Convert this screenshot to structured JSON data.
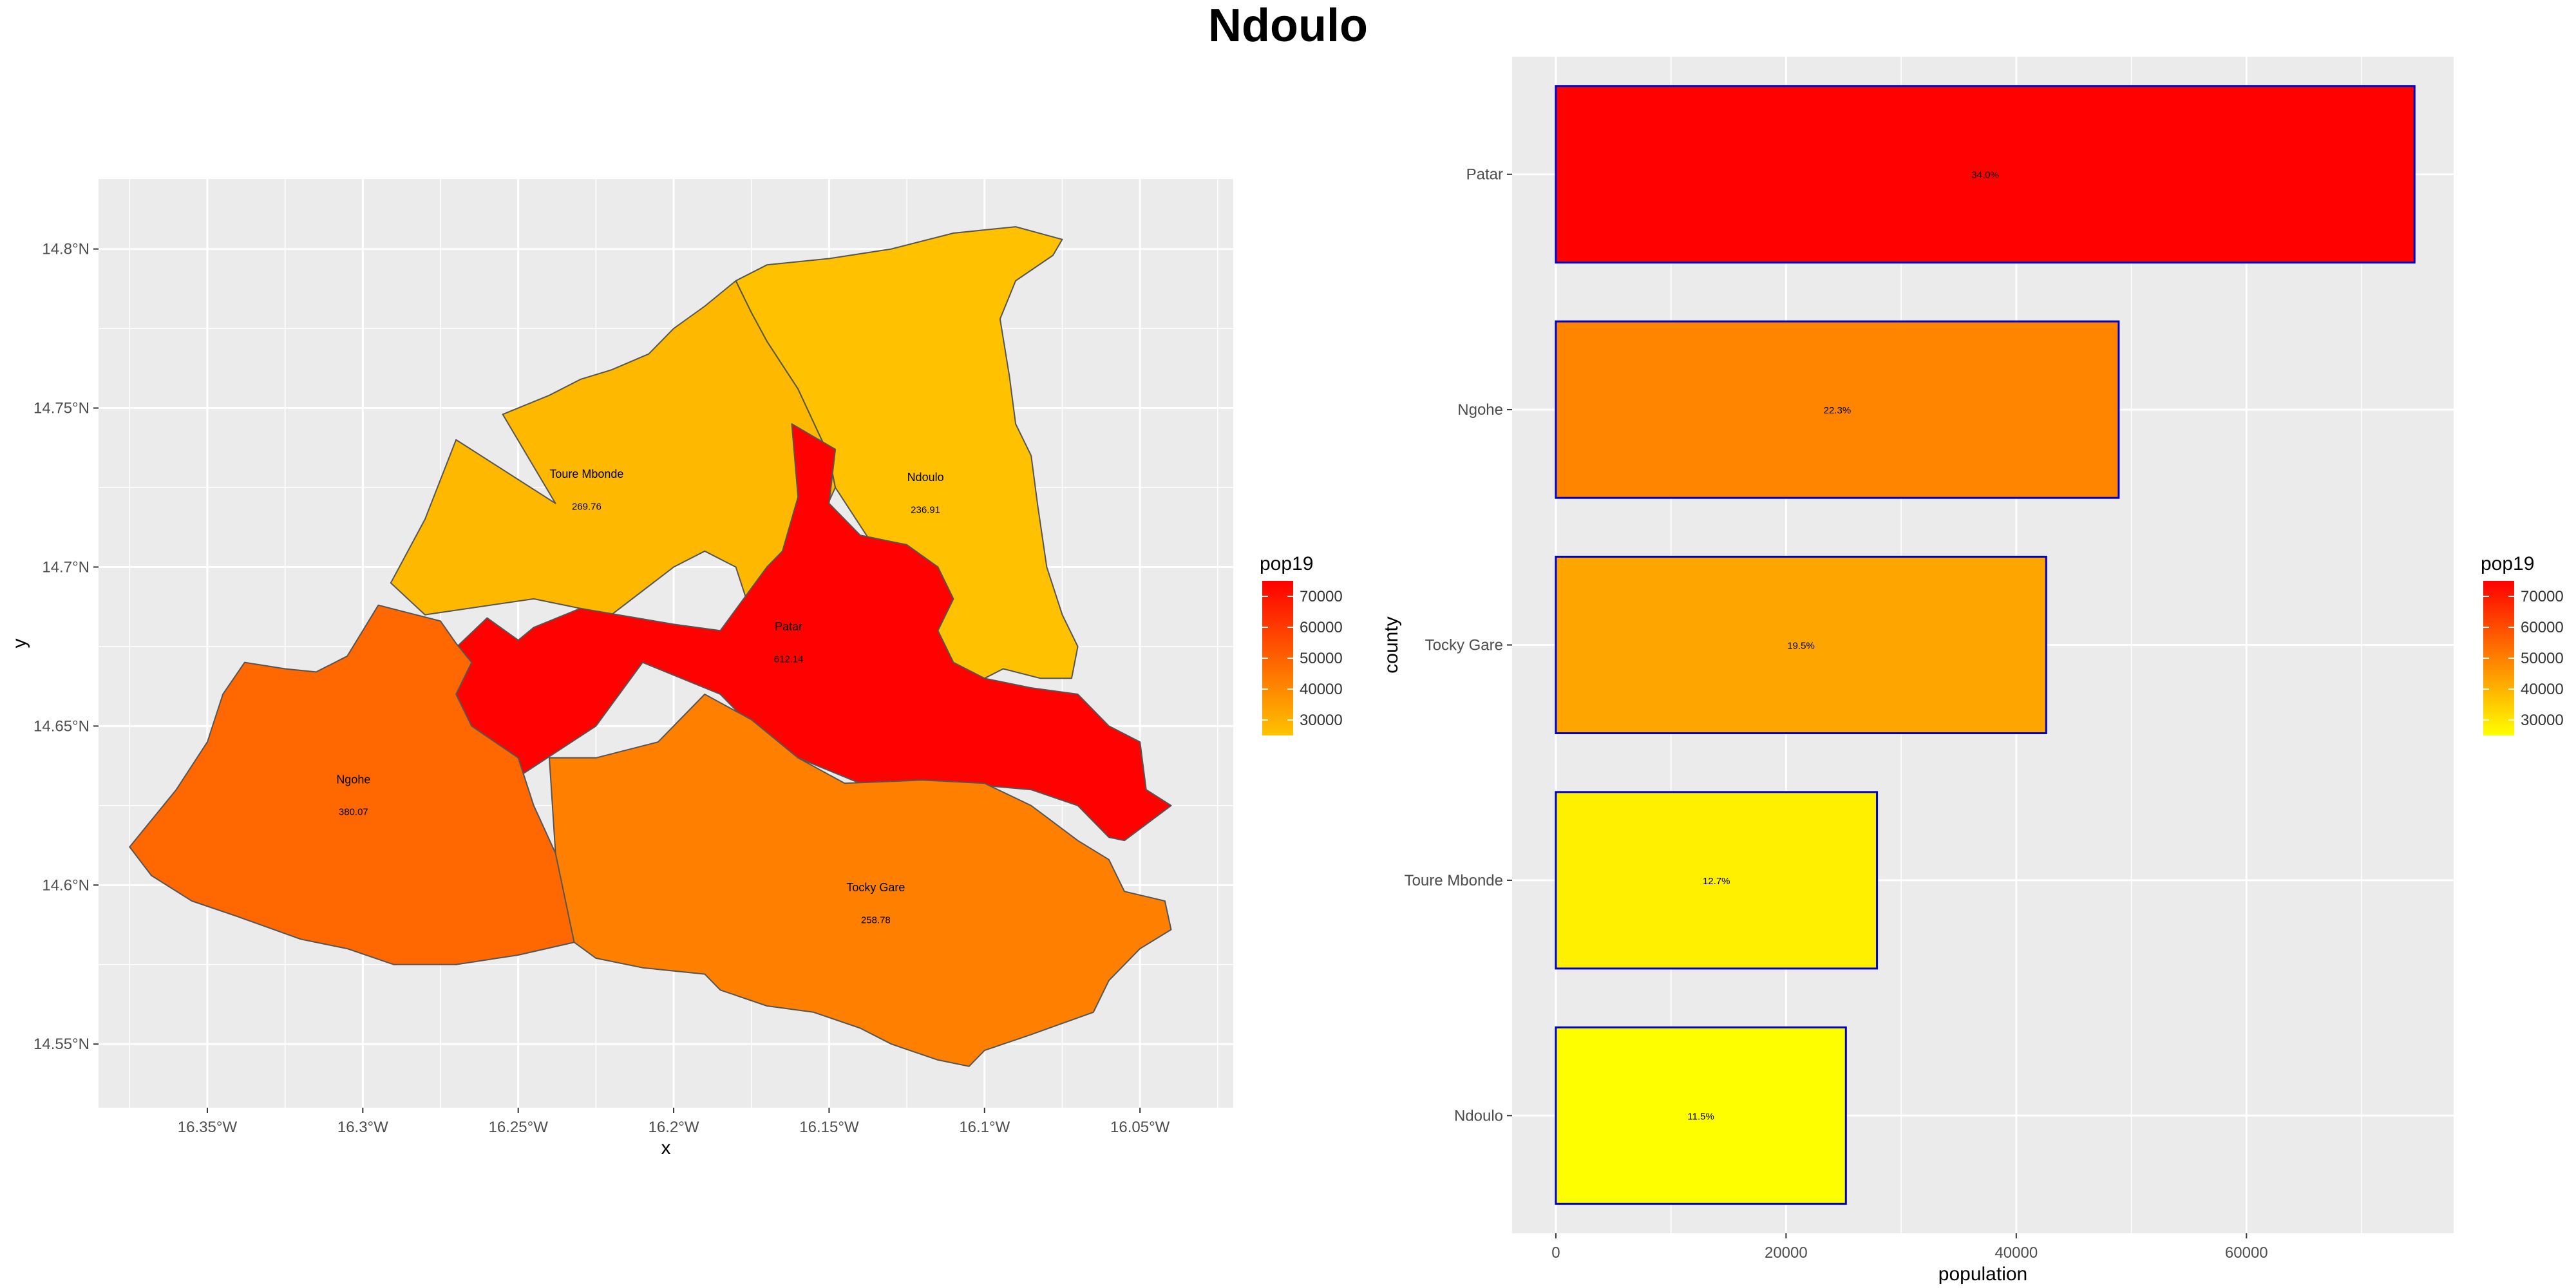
{
  "title": "Ndoulo",
  "colors": {
    "panel_bg": "#EBEBEB",
    "grid": "#FFFFFF",
    "map_low": "#FFC300",
    "map_high": "#FF0000",
    "bar_low": "#FFFF00",
    "bar_high": "#FF0000",
    "bar_outline": "#0000CD",
    "region_outline": "#555555"
  },
  "chart_data": [
    {
      "type": "map",
      "xlabel": "x",
      "ylabel": "y",
      "xlim": [
        -16.385,
        -16.02
      ],
      "ylim": [
        14.53,
        14.822
      ],
      "x_ticks": [
        {
          "value": -16.35,
          "label": "16.35°W"
        },
        {
          "value": -16.3,
          "label": "16.3°W"
        },
        {
          "value": -16.25,
          "label": "16.25°W"
        },
        {
          "value": -16.2,
          "label": "16.2°W"
        },
        {
          "value": -16.15,
          "label": "16.15°W"
        },
        {
          "value": -16.1,
          "label": "16.1°W"
        },
        {
          "value": -16.05,
          "label": "16.05°W"
        }
      ],
      "y_ticks": [
        {
          "value": 14.55,
          "label": "14.55°N"
        },
        {
          "value": 14.6,
          "label": "14.6°N"
        },
        {
          "value": 14.65,
          "label": "14.65°N"
        },
        {
          "value": 14.7,
          "label": "14.7°N"
        },
        {
          "value": 14.75,
          "label": "14.75°N"
        },
        {
          "value": 14.8,
          "label": "14.8°N"
        }
      ],
      "legend": {
        "title": "pop19",
        "placement": "right",
        "range": [
          25000,
          75000
        ],
        "ticks": [
          "70000",
          "60000",
          "50000",
          "40000",
          "30000"
        ]
      },
      "regions": [
        {
          "name": "Toure Mbonde",
          "value_label": "269.76",
          "pop19": 27900,
          "label_pos": [
            -16.228,
            14.728
          ],
          "value_pos": [
            -16.228,
            14.718
          ],
          "polygon": [
            [
              -16.238,
              14.72
            ],
            [
              -16.255,
              14.748
            ],
            [
              -16.24,
              14.754
            ],
            [
              -16.23,
              14.759
            ],
            [
              -16.22,
              14.762
            ],
            [
              -16.208,
              14.767
            ],
            [
              -16.2,
              14.775
            ],
            [
              -16.19,
              14.782
            ],
            [
              -16.18,
              14.79
            ],
            [
              -16.175,
              14.78
            ],
            [
              -16.17,
              14.771
            ],
            [
              -16.16,
              14.756
            ],
            [
              -16.15,
              14.735
            ],
            [
              -16.148,
              14.725
            ],
            [
              -16.155,
              14.71
            ],
            [
              -16.16,
              14.7
            ],
            [
              -16.17,
              14.69
            ],
            [
              -16.175,
              14.685
            ],
            [
              -16.18,
              14.7
            ],
            [
              -16.19,
              14.705
            ],
            [
              -16.2,
              14.7
            ],
            [
              -16.22,
              14.685
            ],
            [
              -16.245,
              14.69
            ],
            [
              -16.28,
              14.685
            ],
            [
              -16.291,
              14.695
            ],
            [
              -16.28,
              14.715
            ],
            [
              -16.27,
              14.74
            ]
          ]
        },
        {
          "name": "Ndoulo",
          "value_label": "236.91",
          "pop19": 25500,
          "label_pos": [
            -16.119,
            14.727
          ],
          "value_pos": [
            -16.119,
            14.717
          ],
          "polygon": [
            [
              -16.18,
              14.79
            ],
            [
              -16.17,
              14.795
            ],
            [
              -16.15,
              14.797
            ],
            [
              -16.13,
              14.8
            ],
            [
              -16.11,
              14.805
            ],
            [
              -16.09,
              14.807
            ],
            [
              -16.075,
              14.803
            ],
            [
              -16.078,
              14.798
            ],
            [
              -16.09,
              14.79
            ],
            [
              -16.095,
              14.778
            ],
            [
              -16.092,
              14.76
            ],
            [
              -16.09,
              14.745
            ],
            [
              -16.085,
              14.735
            ],
            [
              -16.083,
              14.72
            ],
            [
              -16.08,
              14.7
            ],
            [
              -16.075,
              14.685
            ],
            [
              -16.07,
              14.675
            ],
            [
              -16.072,
              14.665
            ],
            [
              -16.082,
              14.665
            ],
            [
              -16.094,
              14.668
            ],
            [
              -16.1,
              14.665
            ],
            [
              -16.11,
              14.668
            ],
            [
              -16.115,
              14.672
            ],
            [
              -16.116,
              14.68
            ],
            [
              -16.118,
              14.688
            ],
            [
              -16.13,
              14.7
            ],
            [
              -16.138,
              14.71
            ],
            [
              -16.148,
              14.725
            ],
            [
              -16.15,
              14.735
            ],
            [
              -16.16,
              14.756
            ],
            [
              -16.17,
              14.771
            ],
            [
              -16.175,
              14.78
            ]
          ]
        },
        {
          "name": "Patar",
          "value_label": "612.14",
          "pop19": 74600,
          "label_pos": [
            -16.163,
            14.68
          ],
          "value_pos": [
            -16.163,
            14.67
          ],
          "polygon": [
            [
              -16.275,
              14.67
            ],
            [
              -16.26,
              14.684
            ],
            [
              -16.25,
              14.677
            ],
            [
              -16.245,
              14.681
            ],
            [
              -16.23,
              14.687
            ],
            [
              -16.2,
              14.682
            ],
            [
              -16.185,
              14.68
            ],
            [
              -16.17,
              14.7
            ],
            [
              -16.165,
              14.705
            ],
            [
              -16.16,
              14.722
            ],
            [
              -16.162,
              14.745
            ],
            [
              -16.148,
              14.737
            ],
            [
              -16.15,
              14.72
            ],
            [
              -16.14,
              14.71
            ],
            [
              -16.125,
              14.707
            ],
            [
              -16.115,
              14.7
            ],
            [
              -16.11,
              14.69
            ],
            [
              -16.115,
              14.68
            ],
            [
              -16.11,
              14.67
            ],
            [
              -16.1,
              14.665
            ],
            [
              -16.085,
              14.662
            ],
            [
              -16.07,
              14.66
            ],
            [
              -16.06,
              14.65
            ],
            [
              -16.05,
              14.645
            ],
            [
              -16.048,
              14.63
            ],
            [
              -16.04,
              14.625
            ],
            [
              -16.055,
              14.614
            ],
            [
              -16.06,
              14.615
            ],
            [
              -16.07,
              14.625
            ],
            [
              -16.085,
              14.63
            ],
            [
              -16.12,
              14.633
            ],
            [
              -16.14,
              14.632
            ],
            [
              -16.16,
              14.64
            ],
            [
              -16.175,
              14.65
            ],
            [
              -16.185,
              14.66
            ],
            [
              -16.21,
              14.67
            ],
            [
              -16.225,
              14.65
            ],
            [
              -16.25,
              14.634
            ],
            [
              -16.265,
              14.65
            ],
            [
              -16.27,
              14.66
            ]
          ]
        },
        {
          "name": "Ngohe",
          "value_label": "380.07",
          "pop19": 48600,
          "label_pos": [
            -16.303,
            14.632
          ],
          "value_pos": [
            -16.303,
            14.622
          ],
          "polygon": [
            [
              -16.375,
              14.612
            ],
            [
              -16.36,
              14.63
            ],
            [
              -16.35,
              14.645
            ],
            [
              -16.345,
              14.66
            ],
            [
              -16.338,
              14.67
            ],
            [
              -16.325,
              14.668
            ],
            [
              -16.315,
              14.667
            ],
            [
              -16.305,
              14.672
            ],
            [
              -16.295,
              14.688
            ],
            [
              -16.275,
              14.683
            ],
            [
              -16.27,
              14.676
            ],
            [
              -16.265,
              14.67
            ],
            [
              -16.27,
              14.66
            ],
            [
              -16.265,
              14.65
            ],
            [
              -16.25,
              14.64
            ],
            [
              -16.245,
              14.625
            ],
            [
              -16.238,
              14.61
            ],
            [
              -16.232,
              14.59
            ],
            [
              -16.232,
              14.582
            ],
            [
              -16.25,
              14.578
            ],
            [
              -16.27,
              14.575
            ],
            [
              -16.29,
              14.575
            ],
            [
              -16.305,
              14.58
            ],
            [
              -16.32,
              14.583
            ],
            [
              -16.34,
              14.59
            ],
            [
              -16.355,
              14.595
            ],
            [
              -16.368,
              14.603
            ]
          ]
        },
        {
          "name": "Tocky Gare",
          "value_label": "258.78",
          "pop19": 42400,
          "label_pos": [
            -16.135,
            14.598
          ],
          "value_pos": [
            -16.135,
            14.588
          ],
          "polygon": [
            [
              -16.238,
              14.61
            ],
            [
              -16.232,
              14.582
            ],
            [
              -16.225,
              14.577
            ],
            [
              -16.21,
              14.574
            ],
            [
              -16.19,
              14.572
            ],
            [
              -16.185,
              14.567
            ],
            [
              -16.17,
              14.562
            ],
            [
              -16.155,
              14.56
            ],
            [
              -16.14,
              14.555
            ],
            [
              -16.13,
              14.55
            ],
            [
              -16.115,
              14.545
            ],
            [
              -16.105,
              14.543
            ],
            [
              -16.1,
              14.548
            ],
            [
              -16.085,
              14.553
            ],
            [
              -16.065,
              14.56
            ],
            [
              -16.06,
              14.57
            ],
            [
              -16.05,
              14.58
            ],
            [
              -16.04,
              14.586
            ],
            [
              -16.042,
              14.595
            ],
            [
              -16.055,
              14.598
            ],
            [
              -16.06,
              14.608
            ],
            [
              -16.07,
              14.614
            ],
            [
              -16.085,
              14.625
            ],
            [
              -16.1,
              14.632
            ],
            [
              -16.12,
              14.633
            ],
            [
              -16.145,
              14.632
            ],
            [
              -16.16,
              14.64
            ],
            [
              -16.175,
              14.652
            ],
            [
              -16.19,
              14.66
            ],
            [
              -16.205,
              14.645
            ],
            [
              -16.225,
              14.64
            ],
            [
              -16.24,
              14.64
            ]
          ]
        }
      ]
    },
    {
      "type": "bar",
      "orientation": "horizontal",
      "xlabel": "population",
      "ylabel": "county",
      "xlim": [
        -3800,
        78000
      ],
      "x_ticks": [
        0,
        20000,
        40000,
        60000
      ],
      "categories": [
        "Patar",
        "Ngohe",
        "Tocky Gare",
        "Toure Mbonde",
        "Ndoulo"
      ],
      "values": [
        74600,
        48900,
        42600,
        27900,
        25200
      ],
      "labels": [
        "34.0%",
        "22.3%",
        "19.5%",
        "12.7%",
        "11.5%"
      ],
      "legend": {
        "title": "pop19",
        "placement": "right",
        "range": [
          25000,
          75000
        ],
        "ticks": [
          "70000",
          "60000",
          "50000",
          "40000",
          "30000"
        ]
      }
    }
  ]
}
